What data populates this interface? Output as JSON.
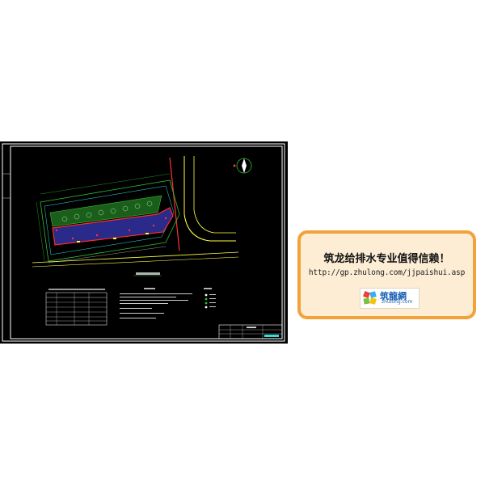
{
  "promo": {
    "title": "筑龙给排水专业值得信赖！",
    "url": "http://gp.zhulong.com/jjpaishui.asp",
    "logo_text": "筑龍網",
    "logo_sub": "zhulong.com"
  },
  "colors": {
    "cad_background": "#000000",
    "promo_background": "#fcedd4",
    "promo_border": "#f2a23a",
    "site_outline": "#ff2a2a",
    "landscape": "#2fbf2f",
    "paving": "#2a2a8a",
    "road": "#ffff44"
  },
  "icons": [
    "north-arrow-icon",
    "zhulong-logo-icon"
  ]
}
